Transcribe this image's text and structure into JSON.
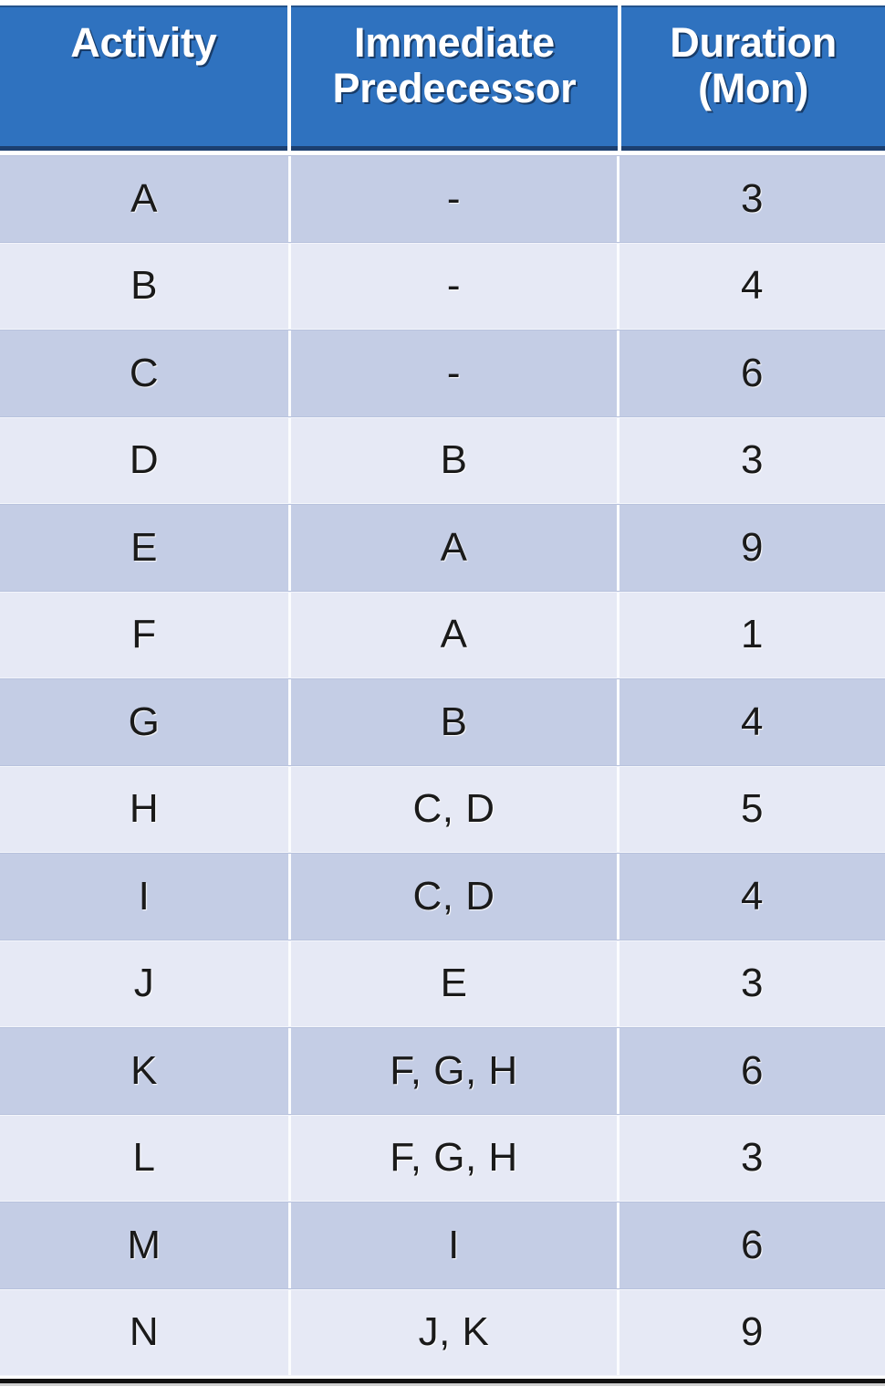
{
  "table": {
    "name": "activity-precedence-duration-table",
    "columns": [
      {
        "key": "activity",
        "label": "Activity"
      },
      {
        "key": "predecessor",
        "label": "Immediate\nPredecessor"
      },
      {
        "key": "duration",
        "label": "Duration\n(Mon)"
      }
    ],
    "rows": [
      {
        "activity": "A",
        "predecessor": "-",
        "duration": "3"
      },
      {
        "activity": "B",
        "predecessor": "-",
        "duration": "4"
      },
      {
        "activity": "C",
        "predecessor": "-",
        "duration": "6"
      },
      {
        "activity": "D",
        "predecessor": "B",
        "duration": "3"
      },
      {
        "activity": "E",
        "predecessor": "A",
        "duration": "9"
      },
      {
        "activity": "F",
        "predecessor": "A",
        "duration": "1"
      },
      {
        "activity": "G",
        "predecessor": "B",
        "duration": "4"
      },
      {
        "activity": "H",
        "predecessor": "C, D",
        "duration": "5"
      },
      {
        "activity": "I",
        "predecessor": "C, D",
        "duration": "4"
      },
      {
        "activity": "J",
        "predecessor": "E",
        "duration": "3"
      },
      {
        "activity": "K",
        "predecessor": "F, G, H",
        "duration": "6"
      },
      {
        "activity": "L",
        "predecessor": "F, G, H",
        "duration": "3"
      },
      {
        "activity": "M",
        "predecessor": "I",
        "duration": "6"
      },
      {
        "activity": "N",
        "predecessor": "J, K",
        "duration": "9"
      }
    ]
  },
  "colors": {
    "header_background": "#2f72bf",
    "header_text": "#ffffff",
    "header_bottom_border": "#1c3f70",
    "row_odd_background": "#c4cde5",
    "row_even_background": "#e6e9f5",
    "cell_text": "#1a1a1a",
    "bottom_rule": "#111111"
  }
}
